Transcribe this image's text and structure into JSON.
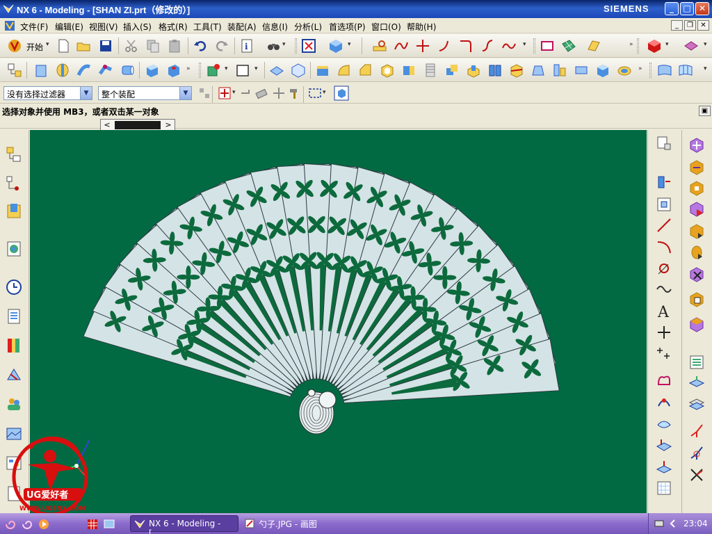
{
  "window": {
    "title": "NX 6 - Modeling - [SHAN ZI.prt（修改的）]",
    "brand": "SIEMENS",
    "buttons": {
      "minimize": "_",
      "maximize": "□",
      "close": "✕"
    }
  },
  "menu": {
    "items": [
      "文件(F)",
      "编辑(E)",
      "视图(V)",
      "插入(S)",
      "格式(R)",
      "工具(T)",
      "装配(A)",
      "信息(I)",
      "分析(L)",
      "首选项(P)",
      "窗口(O)",
      "帮助(H)"
    ]
  },
  "toolbar": {
    "start_label": "开始"
  },
  "selection": {
    "filter_value": "没有选择过滤器",
    "scope_value": "整个装配"
  },
  "cue": {
    "text": "选择对象并使用 MB3，或者双击某一对象"
  },
  "viewport": {
    "background_color": "#026a42",
    "blade_color": "#d4e3e6",
    "pattern_color": "#0c6a3d",
    "blade_count": 24
  },
  "taskbar": {
    "tasks": [
      {
        "label": "NX 6 - Modeling - [...",
        "active": true
      },
      {
        "label": "勺子.JPG - 画图",
        "active": false
      }
    ],
    "clock": "23:04"
  },
  "logo": {
    "text": "UG爱好者",
    "url": "WWW.UGSNX.COM"
  }
}
